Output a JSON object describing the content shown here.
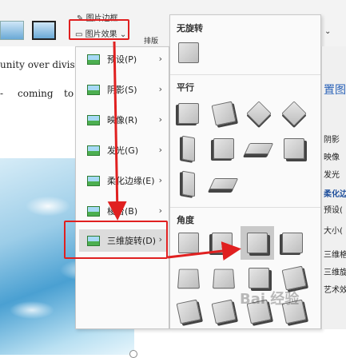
{
  "ribbon": {
    "picture_border": "图片边框",
    "picture_effects": "图片效果",
    "layout_partial": "排版",
    "more": "⌄"
  },
  "document": {
    "line1": "unity over division",
    "line2_a": "-",
    "line2_b": "coming",
    "line2_c": "to",
    "anchor": "↵"
  },
  "effects_menu": {
    "items": [
      {
        "label": "预设(P)"
      },
      {
        "label": "阴影(S)"
      },
      {
        "label": "映像(R)"
      },
      {
        "label": "发光(G)"
      },
      {
        "label": "柔化边缘(E)"
      },
      {
        "label": "棱台(B)"
      },
      {
        "label": "三维旋转(D)"
      }
    ]
  },
  "rotation_menu": {
    "no_rotation": "无旋转",
    "parallel": "平行",
    "perspective": "角度"
  },
  "right_pane": {
    "title": "置图",
    "items": [
      "阴影",
      "映像",
      "发光",
      "柔化边",
      "预设(",
      "大小(",
      "三维格",
      "三维旋",
      "艺术效"
    ]
  },
  "watermark": "Bai 经验",
  "colors": {
    "highlight": "#e02020",
    "arrow": "#e02020"
  }
}
